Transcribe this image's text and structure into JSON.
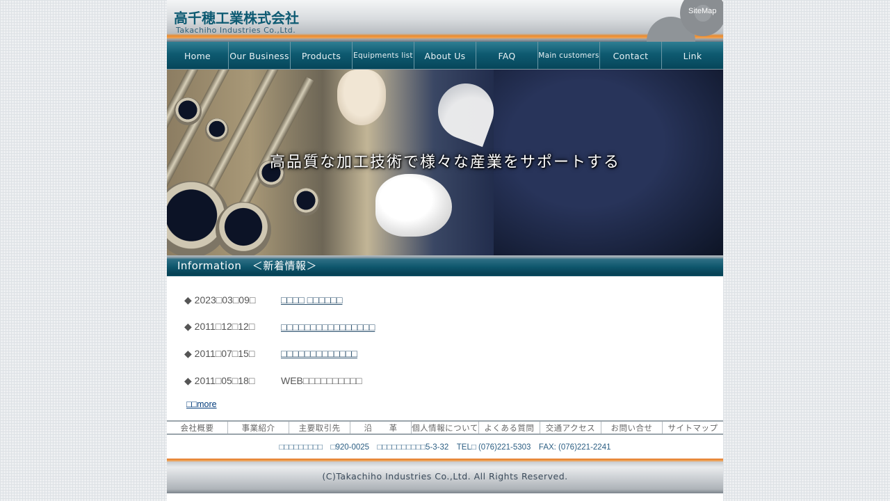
{
  "header": {
    "logo_jp": "高千穂工業株式会社",
    "logo_en": "Takachiho Industries Co.,Ltd.",
    "sitemap_label": "SiteMap"
  },
  "nav": {
    "items": [
      {
        "label": "Home"
      },
      {
        "label": "Our Business"
      },
      {
        "label": "Products"
      },
      {
        "label": "Equipments list"
      },
      {
        "label": "About Us"
      },
      {
        "label": "FAQ"
      },
      {
        "label": "Main customers"
      },
      {
        "label": "Contact"
      },
      {
        "label": "Link"
      }
    ]
  },
  "hero": {
    "caption": "高品質な加工技術で様々な産業をサポートする"
  },
  "info": {
    "heading": "Information　＜新着情報＞"
  },
  "news": {
    "items": [
      {
        "date": "◆ 2023□03□09□",
        "title": "□□□□ □□□□□□"
      },
      {
        "date": "◆ 2011□12□12□",
        "title": "□□□□□□□□□□□□□□□□"
      },
      {
        "date": "◆ 2011□07□15□",
        "title": "□□□□□□□□□□□□□"
      },
      {
        "date": "◆ 2011□05□18□",
        "title": "WEB□□□□□□□□□□"
      }
    ],
    "more_label": "□□more"
  },
  "footer": {
    "nav": [
      {
        "label": "会社概要"
      },
      {
        "label": "事業紹介"
      },
      {
        "label": "主要取引先"
      },
      {
        "label": "沿　　革"
      },
      {
        "label": "個人情報について"
      },
      {
        "label": "よくある質問"
      },
      {
        "label": "交通アクセス"
      },
      {
        "label": "お問い合せ"
      },
      {
        "label": "サイトマップ"
      }
    ],
    "address": "□□□□□□□□□　□920-0025　□□□□□□□□□□5-3-32　TEL□ (076)221-5303　FAX: (076)221-2241",
    "copyright": "(C)Takachiho Industries Co.,Ltd. All Rights Reserved."
  },
  "colors": {
    "nav_bg": "#0e5a70",
    "accent_orange": "#e98a2c",
    "link": "#2a4f6c",
    "address_text": "#2a5d82"
  }
}
